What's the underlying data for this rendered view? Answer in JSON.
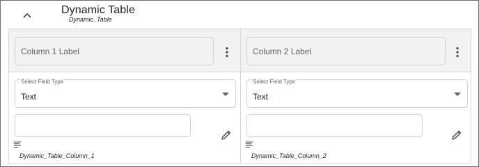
{
  "header": {
    "title": "Dynamic Table",
    "subtitle": "Dynamic_Table",
    "collapse_icon": "chevron-up-icon"
  },
  "columns": [
    {
      "label_placeholder": "Column 1 Label",
      "select_legend": "Select Field Type",
      "select_value": "Text",
      "text_value": "",
      "field_name": "Dynamic_Table_Column_1"
    },
    {
      "label_placeholder": "Column 2 Label",
      "select_legend": "Select Field Type",
      "select_value": "Text",
      "text_value": "",
      "field_name": "Dynamic_Table_Column_2"
    }
  ],
  "colors": {
    "border": "#6b6b6b",
    "header_bg": "#f2f2f2",
    "icon": "#616161",
    "text": "#212121"
  }
}
